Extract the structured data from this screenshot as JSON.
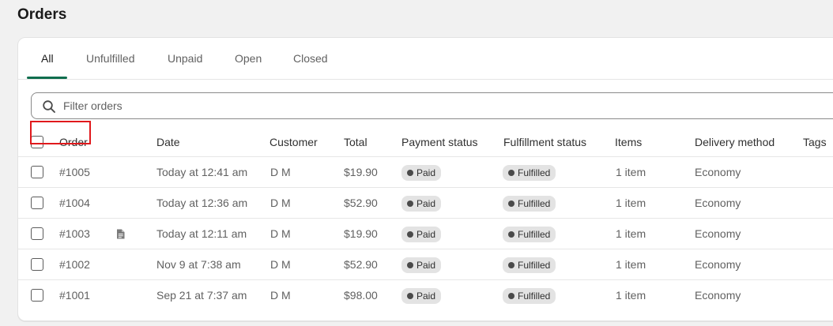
{
  "page": {
    "title": "Orders"
  },
  "tabs": [
    {
      "label": "All",
      "active": true
    },
    {
      "label": "Unfulfilled",
      "active": false
    },
    {
      "label": "Unpaid",
      "active": false
    },
    {
      "label": "Open",
      "active": false
    },
    {
      "label": "Closed",
      "active": false
    }
  ],
  "filter": {
    "placeholder": "Filter orders",
    "value": ""
  },
  "columns": {
    "order": "Order",
    "date": "Date",
    "customer": "Customer",
    "total": "Total",
    "payment_status": "Payment status",
    "fulfillment_status": "Fulfillment status",
    "items": "Items",
    "delivery_method": "Delivery method",
    "tags": "Tags"
  },
  "orders": [
    {
      "order": "#1005",
      "has_note": false,
      "date": "Today at 12:41 am",
      "customer": "D M",
      "total": "$19.90",
      "payment_status": "Paid",
      "fulfillment_status": "Fulfilled",
      "items": "1 item",
      "delivery_method": "Economy",
      "highlighted": true
    },
    {
      "order": "#1004",
      "has_note": false,
      "date": "Today at 12:36 am",
      "customer": "D M",
      "total": "$52.90",
      "payment_status": "Paid",
      "fulfillment_status": "Fulfilled",
      "items": "1 item",
      "delivery_method": "Economy",
      "highlighted": false
    },
    {
      "order": "#1003",
      "has_note": true,
      "date": "Today at 12:11 am",
      "customer": "D M",
      "total": "$19.90",
      "payment_status": "Paid",
      "fulfillment_status": "Fulfilled",
      "items": "1 item",
      "delivery_method": "Economy",
      "highlighted": false
    },
    {
      "order": "#1002",
      "has_note": false,
      "date": "Nov 9 at 7:38 am",
      "customer": "D M",
      "total": "$52.90",
      "payment_status": "Paid",
      "fulfillment_status": "Fulfilled",
      "items": "1 item",
      "delivery_method": "Economy",
      "highlighted": false
    },
    {
      "order": "#1001",
      "has_note": false,
      "date": "Sep 21 at 7:37 am",
      "customer": "D M",
      "total": "$98.00",
      "payment_status": "Paid",
      "fulfillment_status": "Fulfilled",
      "items": "1 item",
      "delivery_method": "Economy",
      "highlighted": false
    }
  ],
  "icons": {
    "filter": "search-icon",
    "note": "note-icon"
  },
  "colors": {
    "accent": "#0f6e4e",
    "highlight": "#e0191c",
    "badge_bg": "#e3e3e3"
  }
}
